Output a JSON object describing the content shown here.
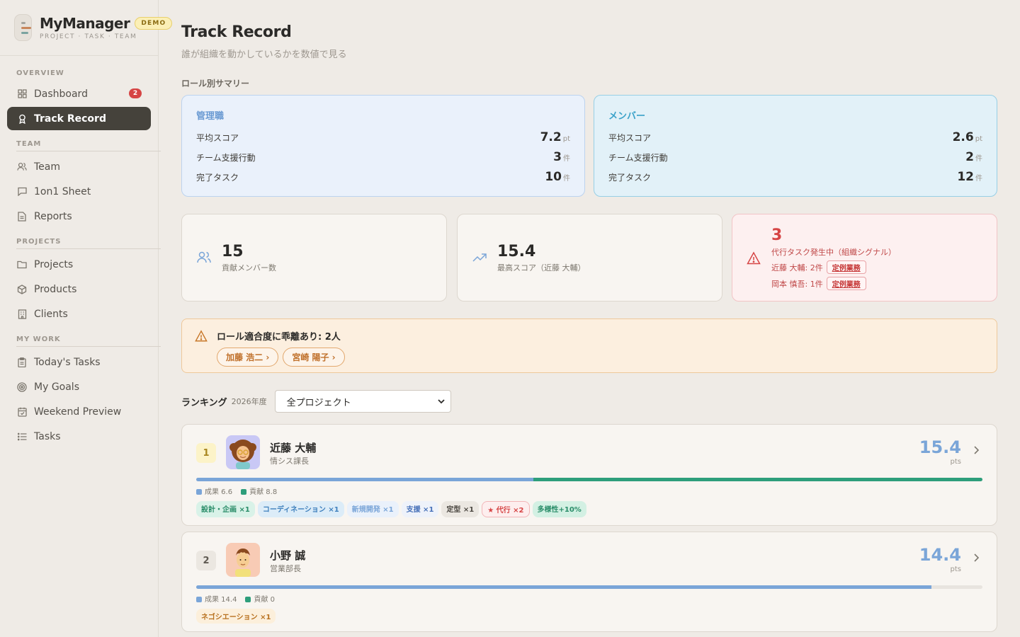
{
  "brand": {
    "title": "MyManager",
    "badge": "DEMO",
    "subtitle": "PROJECT · TASK · TEAM"
  },
  "sidebar": {
    "sections": [
      {
        "label": "OVERVIEW"
      },
      {
        "label": "TEAM"
      },
      {
        "label": "PROJECTS"
      },
      {
        "label": "MY WORK"
      }
    ],
    "items": [
      {
        "label": "Dashboard",
        "icon": "grid-icon",
        "badge": "2"
      },
      {
        "label": "Track Record",
        "icon": "award-icon",
        "active": true
      },
      {
        "label": "Team",
        "icon": "users-icon"
      },
      {
        "label": "1on1 Sheet",
        "icon": "chat-icon"
      },
      {
        "label": "Reports",
        "icon": "document-icon"
      },
      {
        "label": "Projects",
        "icon": "folder-icon"
      },
      {
        "label": "Products",
        "icon": "box-icon"
      },
      {
        "label": "Clients",
        "icon": "building-icon"
      },
      {
        "label": "Today's Tasks",
        "icon": "clipboard-icon"
      },
      {
        "label": "My Goals",
        "icon": "target-icon"
      },
      {
        "label": "Weekend Preview",
        "icon": "calendar-icon"
      },
      {
        "label": "Tasks",
        "icon": "list-icon"
      }
    ]
  },
  "page": {
    "title": "Track Record",
    "subtitle": "誰が組織を動かしているかを数値で見る"
  },
  "summary": {
    "label": "ロール別サマリー",
    "manager": {
      "name": "管理職",
      "rows": [
        {
          "label": "平均スコア",
          "value": "7.2",
          "unit": "pt"
        },
        {
          "label": "チーム支援行動",
          "value": "3",
          "unit": "件"
        },
        {
          "label": "完了タスク",
          "value": "10",
          "unit": "件"
        }
      ]
    },
    "member": {
      "name": "メンバー",
      "rows": [
        {
          "label": "平均スコア",
          "value": "2.6",
          "unit": "pt"
        },
        {
          "label": "チーム支援行動",
          "value": "2",
          "unit": "件"
        },
        {
          "label": "完了タスク",
          "value": "12",
          "unit": "件"
        }
      ]
    }
  },
  "stats": {
    "members": {
      "value": "15",
      "label": "貢献メンバー数"
    },
    "top": {
      "value": "15.4",
      "label": "最高スコア（近藤 大輔）"
    },
    "alert": {
      "value": "3",
      "label": "代行タスク発生中（組織シグナル）",
      "lines": [
        {
          "text": "近藤 大輔: 2件",
          "tag": "定例業務"
        },
        {
          "text": "岡本 慎吾: 1件",
          "tag": "定例業務"
        }
      ]
    }
  },
  "warning": {
    "title": "ロール適合度に乖離あり: 2人",
    "chips": [
      "加藤 浩二 ›",
      "宮崎 陽子 ›"
    ]
  },
  "ranking": {
    "title": "ランキング",
    "year": "2026年度",
    "filter": "全プロジェクト",
    "rows": [
      {
        "rank": "1",
        "name": "近藤 大輔",
        "role": "情シス課長",
        "score": "15.4",
        "pts": "pts",
        "achievement": 6.6,
        "contribution": 8.8,
        "legend_a": "成果 6.6",
        "legend_b": "貢献 8.8",
        "tags": [
          "設計・企画 ×1",
          "コーディネーション ×1",
          "新規開発 ×1",
          "支援 ×1",
          "定型 ×1",
          "★ 代行 ×2",
          "多様性+10%"
        ]
      },
      {
        "rank": "2",
        "name": "小野 誠",
        "role": "営業部長",
        "score": "14.4",
        "pts": "pts",
        "achievement": 14.4,
        "contribution": 0,
        "legend_a": "成果 14.4",
        "legend_b": "貢献 0",
        "tags": [
          "ネゴシエーション ×1"
        ]
      }
    ]
  },
  "colors": {
    "accent_blue": "#7aa5d8",
    "accent_green": "#2e9e7b",
    "danger": "#d64545",
    "warning": "#c8782a"
  }
}
